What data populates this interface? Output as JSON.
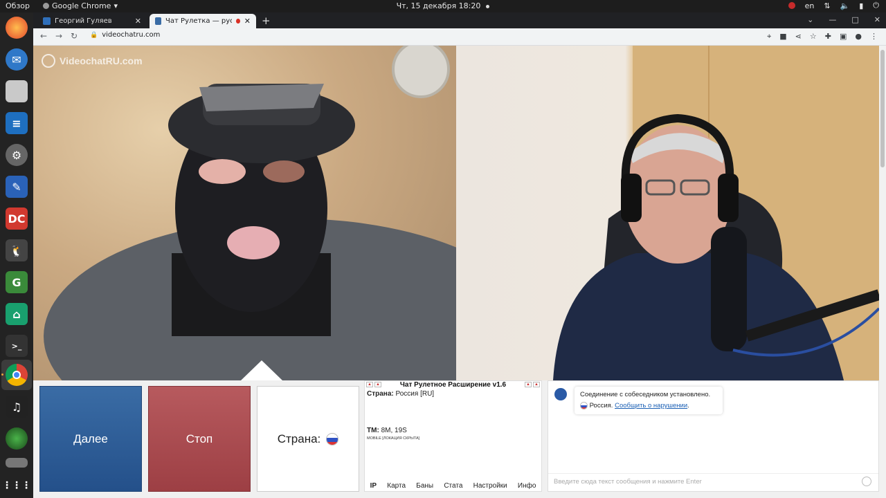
{
  "topbar": {
    "overview": "Обзор",
    "app_name": "Google Chrome",
    "clock": "Чт, 15 декабря  18:20",
    "lang": "en"
  },
  "browser": {
    "tabs": [
      {
        "title": "Георгий Гуляев",
        "favicon_color": "#2f6fba"
      },
      {
        "title": "Чат Рулетка — русски",
        "favicon_color": "#3a6ca5"
      }
    ],
    "url": "videochatru.com"
  },
  "video": {
    "watermark": "VideochatRU.com"
  },
  "controls": {
    "next_label": "Далее",
    "stop_label": "Стоп",
    "country_label": "Страна:"
  },
  "extension": {
    "title": "Чат Рулетное Расширение v1.6",
    "country_label": "Страна:",
    "country_value": "Россия [RU]",
    "tm_label": "TM:",
    "tm_value": "8M, 19S",
    "mobile_note": "MOBILE [ЛОКАЦИЯ СКРЫТА]",
    "menu": [
      "IP",
      "Карта",
      "Баны",
      "Стата",
      "Настройки",
      "Инфо"
    ]
  },
  "chat": {
    "system_message": "Соединение с собеседником установлено.",
    "country": "Россия.",
    "report_link": "Сообщить о нарушении",
    "report_suffix": ".",
    "input_placeholder": "Введите сюда текст сообщения и нажмите Enter"
  }
}
